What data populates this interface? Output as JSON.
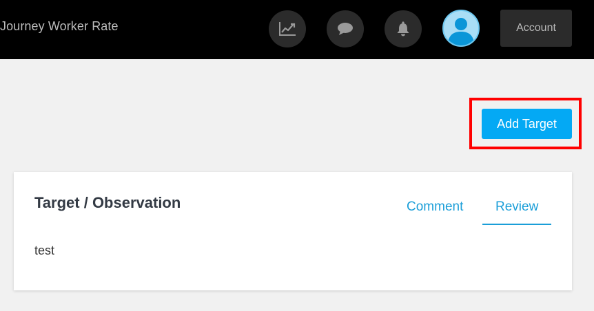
{
  "header": {
    "title": "Journey Worker Rate",
    "icons": [
      "chart-icon",
      "chat-icon",
      "bell-icon",
      "user-avatar-icon"
    ],
    "account_label": "Account"
  },
  "toolbar": {
    "add_target_label": "Add Target"
  },
  "card": {
    "title": "Target / Observation",
    "tabs": [
      {
        "label": "Comment",
        "active": false
      },
      {
        "label": "Review",
        "active": true
      }
    ],
    "body_text": "test"
  },
  "colors": {
    "topbar": "#000000",
    "icon_button": "#2b2b2b",
    "accent": "#04a9f4",
    "tab_text": "#1a9ed8",
    "highlight": "#ff0000",
    "background": "#f1f1f1"
  }
}
